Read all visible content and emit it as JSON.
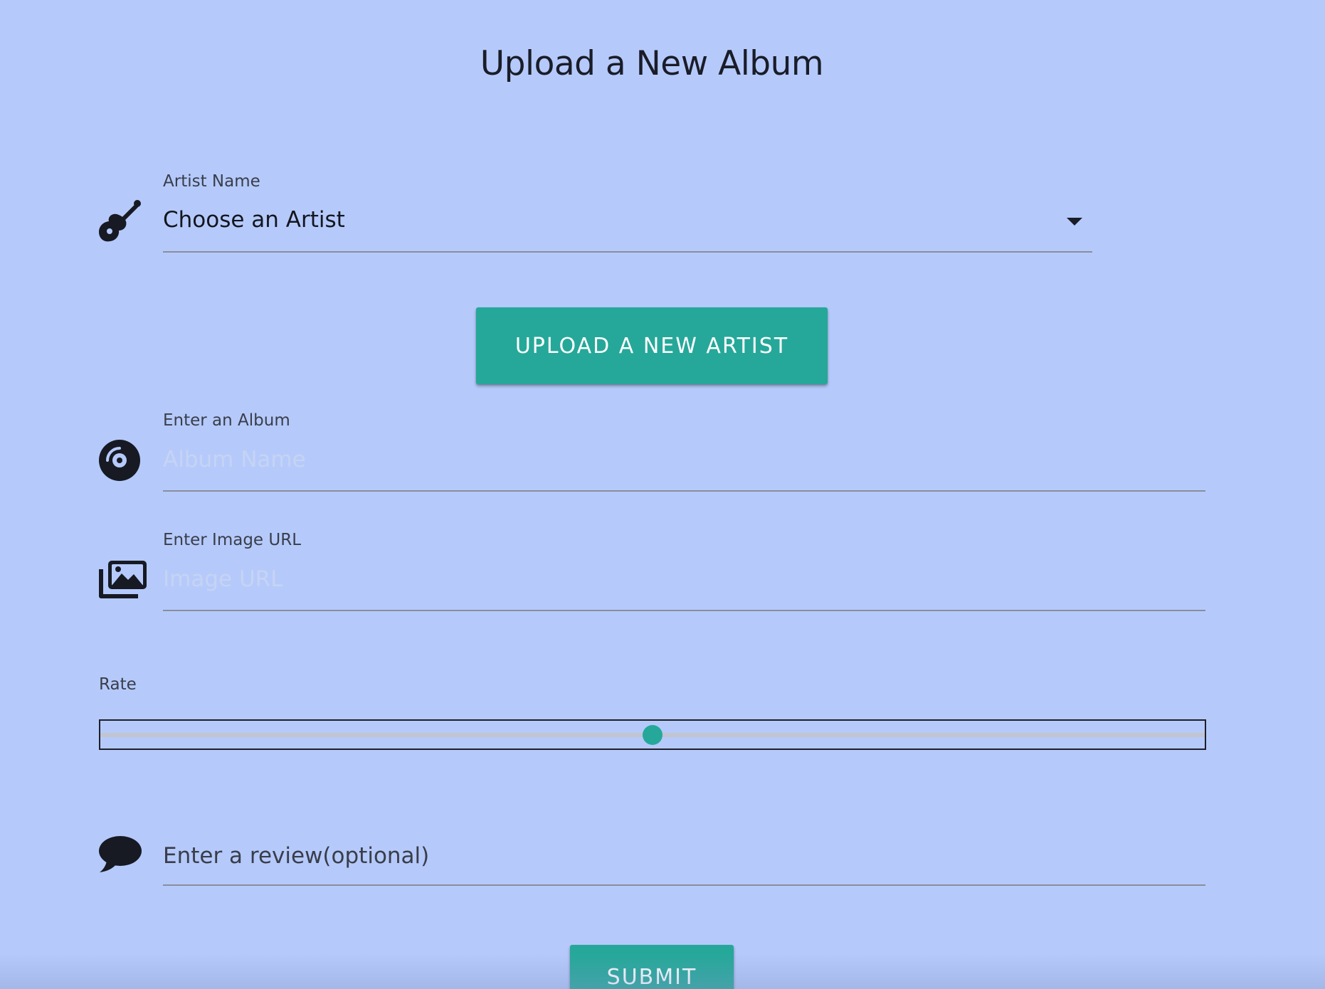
{
  "page": {
    "title": "Upload a New Album",
    "accent_color": "#25a899",
    "background_color": "#b5cafb"
  },
  "artist": {
    "label": "Artist Name",
    "selected": "Choose an Artist",
    "icon": "guitar-icon"
  },
  "upload_artist_button": {
    "label": "UPLOAD A NEW ARTIST"
  },
  "album": {
    "label": "Enter an Album",
    "placeholder": "Album Name",
    "value": "",
    "icon": "vinyl-record-icon"
  },
  "image_url": {
    "label": "Enter Image URL",
    "placeholder": "Image URL",
    "value": "",
    "icon": "images-icon"
  },
  "rate": {
    "label": "Rate",
    "value_fraction": 0.5
  },
  "review": {
    "placeholder": "Enter a review(optional)",
    "value": "",
    "icon": "speech-bubble-icon"
  },
  "submit_button": {
    "label": "SUBMIT"
  }
}
